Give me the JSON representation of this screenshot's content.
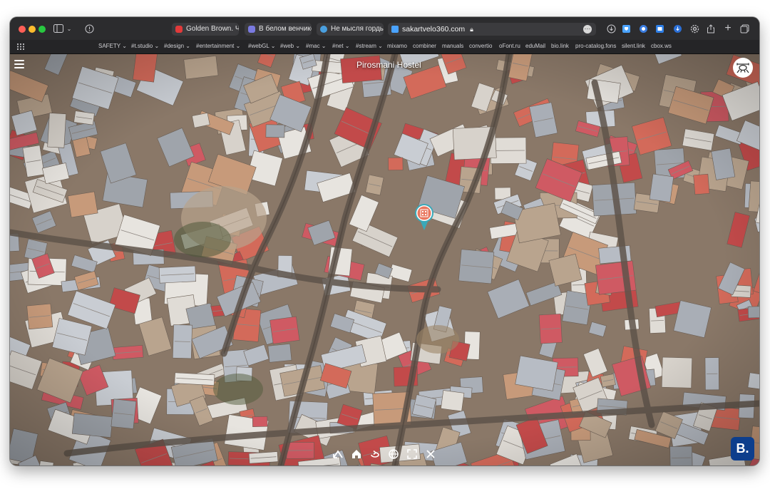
{
  "browser": {
    "tabs": [
      {
        "label": "Golden Brown. Ч...",
        "favicon_color": "#e23a3a"
      },
      {
        "label": "В белом венчике...",
        "favicon_color": "#7a7ae0"
      },
      {
        "label": "Не мысля горды...",
        "favicon_color": "#4aa0e0"
      }
    ],
    "address": {
      "url": "sakartvelo360.com"
    },
    "bookmarks": [
      "SAFETY",
      "#t.studio",
      "#design",
      "#entertainment",
      "#webGL",
      "#web",
      "#mac",
      "#net",
      "#stream",
      "mixamo",
      "combiner",
      "manuals",
      "convertio",
      "oFont.ru",
      "eduMail",
      "bio.link",
      "pro-catalog.fons",
      "silent.link",
      "cbox.ws"
    ],
    "bookmark_dropdowns": [
      "SAFETY",
      "#t.studio",
      "#design",
      "#entertainment",
      "#webGL",
      "#web",
      "#mac",
      "#net",
      "#stream"
    ]
  },
  "viewer": {
    "title": "Pirosmani Hostel",
    "booking_label": "B.",
    "controls": [
      "go-back-icon",
      "home-icon",
      "rotate-icon",
      "globe-icon",
      "fullscreen-icon",
      "close-icon"
    ]
  },
  "colors": {
    "booking_blue": "#0d3e8c",
    "pin_teal": "#3aa8b8",
    "roof_red": "#c24a4a",
    "roof_grey": "#b7bcc4"
  }
}
